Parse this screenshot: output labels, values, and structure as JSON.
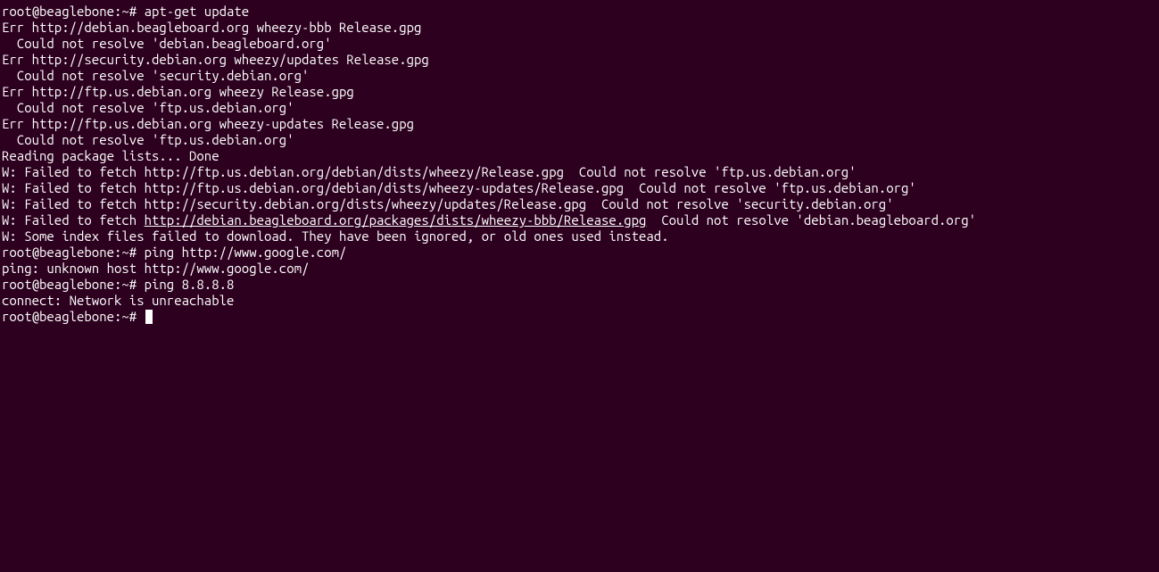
{
  "terminal": {
    "lines": [
      {
        "parts": [
          {
            "t": "root@beaglebone:~# apt-get update"
          }
        ]
      },
      {
        "parts": [
          {
            "t": "Err http://debian.beagleboard.org wheezy-bbb Release.gpg"
          }
        ]
      },
      {
        "parts": [
          {
            "t": "  Could not resolve 'debian.beagleboard.org'"
          }
        ]
      },
      {
        "parts": [
          {
            "t": "Err http://security.debian.org wheezy/updates Release.gpg"
          }
        ]
      },
      {
        "parts": [
          {
            "t": "  Could not resolve 'security.debian.org'"
          }
        ]
      },
      {
        "parts": [
          {
            "t": "Err http://ftp.us.debian.org wheezy Release.gpg"
          }
        ]
      },
      {
        "parts": [
          {
            "t": "  Could not resolve 'ftp.us.debian.org'"
          }
        ]
      },
      {
        "parts": [
          {
            "t": "Err http://ftp.us.debian.org wheezy-updates Release.gpg"
          }
        ]
      },
      {
        "parts": [
          {
            "t": "  Could not resolve 'ftp.us.debian.org'"
          }
        ]
      },
      {
        "parts": [
          {
            "t": "Reading package lists... Done"
          }
        ]
      },
      {
        "parts": [
          {
            "t": "W: Failed to fetch http://ftp.us.debian.org/debian/dists/wheezy/Release.gpg  Could not resolve 'ftp.us.debian.org'"
          }
        ]
      },
      {
        "parts": [
          {
            "t": ""
          }
        ]
      },
      {
        "parts": [
          {
            "t": "W: Failed to fetch http://ftp.us.debian.org/debian/dists/wheezy-updates/Release.gpg  Could not resolve 'ftp.us.debian.org'"
          }
        ]
      },
      {
        "parts": [
          {
            "t": ""
          }
        ]
      },
      {
        "parts": [
          {
            "t": "W: Failed to fetch http://security.debian.org/dists/wheezy/updates/Release.gpg  Could not resolve 'security.debian.org'"
          }
        ]
      },
      {
        "parts": [
          {
            "t": ""
          }
        ]
      },
      {
        "parts": [
          {
            "t": "W: Failed to fetch "
          },
          {
            "t": "http://debian.beagleboard.org/packages/dists/wheezy-bbb/Release.gpg",
            "link": true
          },
          {
            "t": "  Could not resolve 'debian.beagleboard.org'"
          }
        ]
      },
      {
        "parts": [
          {
            "t": ""
          }
        ]
      },
      {
        "parts": [
          {
            "t": "W: Some index files failed to download. They have been ignored, or old ones used instead."
          }
        ]
      },
      {
        "parts": [
          {
            "t": "root@beaglebone:~# ping http://www.google.com/"
          }
        ]
      },
      {
        "parts": [
          {
            "t": "ping: unknown host http://www.google.com/"
          }
        ]
      },
      {
        "parts": [
          {
            "t": "root@beaglebone:~# ping 8.8.8.8"
          }
        ]
      },
      {
        "parts": [
          {
            "t": "connect: Network is unreachable"
          }
        ]
      },
      {
        "parts": [
          {
            "t": "root@beaglebone:~# "
          }
        ],
        "cursor": true
      }
    ]
  }
}
